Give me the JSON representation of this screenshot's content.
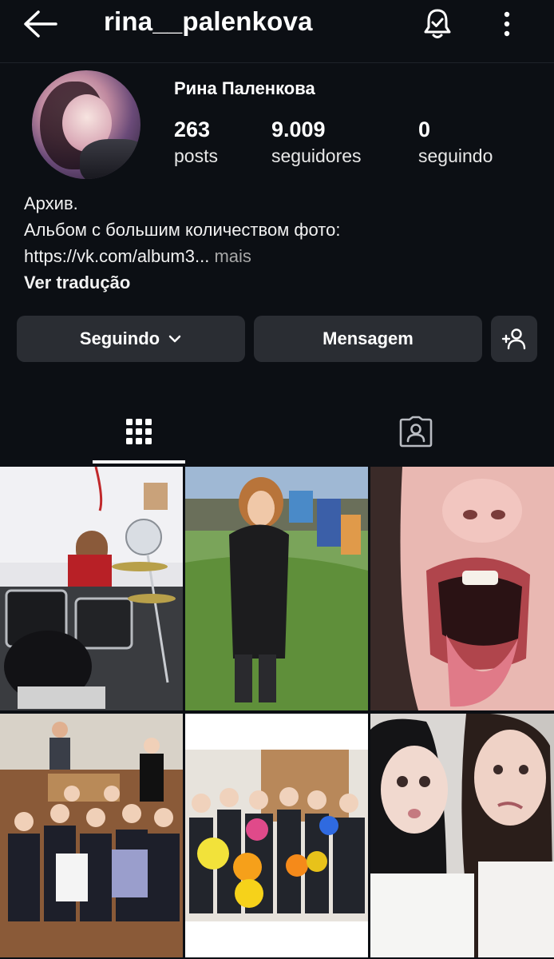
{
  "header": {
    "username": "rina__palenkova",
    "icons": [
      "back-arrow-icon",
      "notification-bell-icon",
      "more-options-icon"
    ]
  },
  "profile": {
    "display_name": "Рина Паленкова",
    "stats": [
      {
        "value": "263",
        "label": "posts"
      },
      {
        "value": "9.009",
        "label": "seguidores"
      },
      {
        "value": "0",
        "label": "seguindo"
      }
    ],
    "bio_line1": "Архив.",
    "bio_line2": "Альбом с большим количеством фото:",
    "bio_link": "https://vk.com/album3...",
    "bio_more": "mais",
    "translate": "Ver tradução"
  },
  "actions": {
    "following_label": "Seguindo",
    "message_label": "Mensagem",
    "add_user_icon": "add-person-icon"
  },
  "tabs": {
    "icons": [
      "grid-icon",
      "tagged-person-icon"
    ],
    "active": "grid"
  },
  "colors": {
    "background": "#0c0f14",
    "button": "#2a2d33",
    "muted_text": "#a8a8a8"
  }
}
